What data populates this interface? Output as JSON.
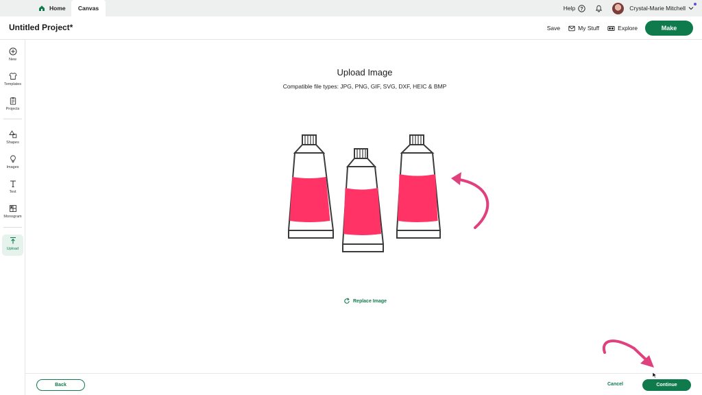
{
  "tabs": {
    "home": "Home",
    "canvas": "Canvas"
  },
  "top_right": {
    "help": "Help",
    "user_name": "Crystal-Marie Mitchell"
  },
  "header": {
    "project_title": "Untitled Project*",
    "save": "Save",
    "my_stuff": "My Stuff",
    "explore": "Explore",
    "make": "Make"
  },
  "sidebar": {
    "items": [
      {
        "label": "New",
        "icon": "plus-circle-icon"
      },
      {
        "label": "Templates",
        "icon": "shirt-icon"
      },
      {
        "label": "Projects",
        "icon": "clipboard-icon"
      },
      {
        "label": "Shapes",
        "icon": "shapes-icon"
      },
      {
        "label": "Images",
        "icon": "lightbulb-icon"
      },
      {
        "label": "Text",
        "icon": "text-icon"
      },
      {
        "label": "Monogram",
        "icon": "monogram-icon"
      },
      {
        "label": "Upload",
        "icon": "upload-icon"
      }
    ],
    "active": "Upload"
  },
  "main": {
    "title": "Upload Image",
    "file_types": "Compatible file types:  JPG, PNG, GIF, SVG, DXF, HEIC & BMP",
    "replace_image": "Replace Image"
  },
  "footer": {
    "back": "Back",
    "cancel": "Cancel",
    "continue": "Continue"
  },
  "colors": {
    "accent": "#0f7a4c",
    "paint": "#ff3366",
    "annotation": "#e0407e"
  }
}
